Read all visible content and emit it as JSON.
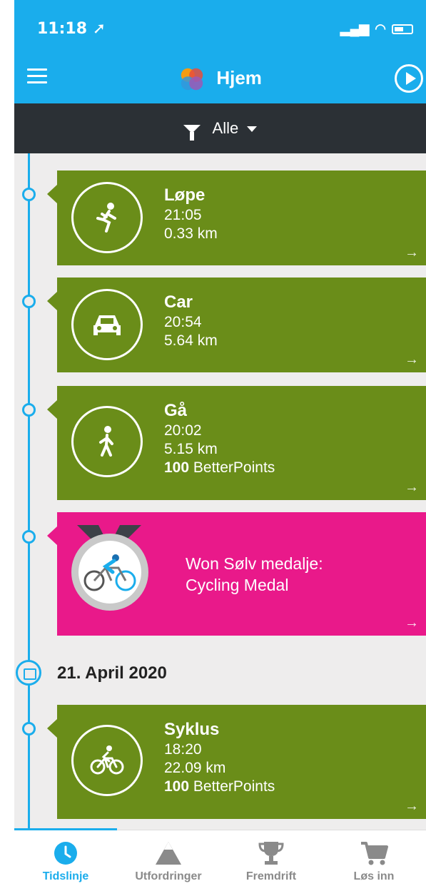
{
  "status_bar": {
    "time": "11:18",
    "signal": "signal-icon",
    "wifi": "wifi-icon",
    "battery": "battery-icon"
  },
  "header": {
    "title": "Hjem",
    "menu_icon": "hamburger-menu-icon",
    "play_icon": "play-icon",
    "logo": "app-logo-icon"
  },
  "filter": {
    "label": "Alle",
    "icon": "filter-funnel-icon"
  },
  "timeline": {
    "entries": [
      {
        "title": "Løpe",
        "time": "21:05",
        "distance": "0.33 km",
        "icon": "running-icon"
      },
      {
        "title": "Car",
        "time": "20:54",
        "distance": "5.64 km",
        "icon": "car-icon"
      },
      {
        "title": "Gå",
        "time": "20:02",
        "distance": "5.15 km",
        "points_value": "100",
        "points_label": "BetterPoints",
        "icon": "walking-icon"
      }
    ],
    "medal": {
      "line1": "Won Sølv medalje:",
      "line2": "Cycling Medal",
      "icon": "cycling-medal-icon"
    },
    "date": "21. April 2020",
    "entries_after_date": [
      {
        "title": "Syklus",
        "time": "18:20",
        "distance": "22.09 km",
        "points_value": "100",
        "points_label": "BetterPoints",
        "icon": "bicycle-icon"
      }
    ],
    "arrow": "→"
  },
  "tabs": [
    {
      "label": "Tidslinje",
      "icon": "clock-icon",
      "active": true
    },
    {
      "label": "Utfordringer",
      "icon": "mountain-icon",
      "active": false
    },
    {
      "label": "Fremdrift",
      "icon": "trophy-icon",
      "active": false
    },
    {
      "label": "Løs inn",
      "icon": "cart-icon",
      "active": false
    }
  ],
  "colors": {
    "brand_blue": "#1aadec",
    "activity_green": "#6a8d19",
    "medal_pink": "#e9198a",
    "filter_dark": "#2b3035"
  }
}
